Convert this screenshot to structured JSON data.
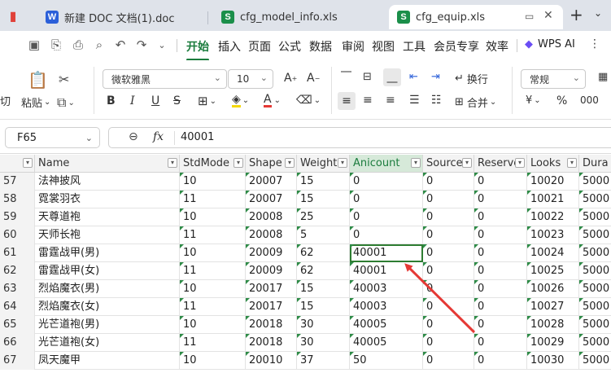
{
  "tabs": [
    {
      "label": "新建 DOC 文档(1).doc",
      "badge": "W",
      "badge_color": "#2b5fd9",
      "active": false
    },
    {
      "label": "cfg_model_info.xls",
      "badge": "S",
      "badge_color": "#1b8f4a",
      "active": false
    },
    {
      "label": "cfg_equip.xls",
      "badge": "S",
      "badge_color": "#1b8f4a",
      "active": true
    }
  ],
  "tabbar_icons": [
    "pdf-icon",
    "window-restore-icon",
    "close-icon",
    "new-tab-icon",
    "chevron-down-icon"
  ],
  "menu_tabs": [
    "开始",
    "插入",
    "页面",
    "公式",
    "数据",
    "审阅",
    "视图",
    "工具",
    "会员专享",
    "效率"
  ],
  "active_menu": "开始",
  "wps_ai": "WPS AI",
  "ribbon": {
    "cut_label": "剪切",
    "paste_label": "粘贴",
    "font_name": "微软雅黑",
    "font_size": "10",
    "wrap_label": "换行",
    "merge_label": "合并",
    "number_format": "常规",
    "currency_symbol": "¥"
  },
  "formula_bar": {
    "cell_ref": "F65",
    "fx": "fx",
    "value": "40001"
  },
  "columns": [
    "Name",
    "StdMode",
    "Shape",
    "Weight",
    "Anicount",
    "Source",
    "Reserve",
    "Looks",
    "Dura"
  ],
  "rows": [
    {
      "num": "57",
      "cells": [
        "法神披风",
        "10",
        "20007",
        "15",
        "0",
        "0",
        "0",
        "10020",
        "5000"
      ]
    },
    {
      "num": "58",
      "cells": [
        "霓裳羽衣",
        "11",
        "20007",
        "15",
        "0",
        "0",
        "0",
        "10021",
        "5000"
      ]
    },
    {
      "num": "59",
      "cells": [
        "天尊道袍",
        "10",
        "20008",
        "25",
        "0",
        "0",
        "0",
        "10022",
        "5000"
      ]
    },
    {
      "num": "60",
      "cells": [
        "天师长袍",
        "11",
        "20008",
        "5",
        "0",
        "0",
        "0",
        "10023",
        "5000"
      ]
    },
    {
      "num": "61",
      "cells": [
        "雷霆战甲(男)",
        "10",
        "20009",
        "62",
        "40001",
        "0",
        "0",
        "10024",
        "5000"
      ]
    },
    {
      "num": "62",
      "cells": [
        "雷霆战甲(女)",
        "11",
        "20009",
        "62",
        "40001",
        "0",
        "0",
        "10025",
        "5000"
      ]
    },
    {
      "num": "63",
      "cells": [
        "烈焰魔衣(男)",
        "10",
        "20017",
        "15",
        "40003",
        "0",
        "0",
        "10026",
        "5000"
      ]
    },
    {
      "num": "64",
      "cells": [
        "烈焰魔衣(女)",
        "11",
        "20017",
        "15",
        "40003",
        "0",
        "0",
        "10027",
        "5000"
      ]
    },
    {
      "num": "65",
      "cells": [
        "光芒道袍(男)",
        "10",
        "20018",
        "30",
        "40005",
        "0",
        "0",
        "10028",
        "5000"
      ]
    },
    {
      "num": "66",
      "cells": [
        "光芒道袍(女)",
        "11",
        "20018",
        "30",
        "40005",
        "0",
        "0",
        "10029",
        "5000"
      ]
    },
    {
      "num": "67",
      "cells": [
        "凤天魔甲",
        "10",
        "20010",
        "37",
        "50",
        "0",
        "0",
        "10030",
        "5000"
      ]
    }
  ],
  "selected": {
    "row": 4,
    "col": 4
  },
  "colors": {
    "accent": "#1b7c3d",
    "annotation_arrow": "#e53935"
  }
}
